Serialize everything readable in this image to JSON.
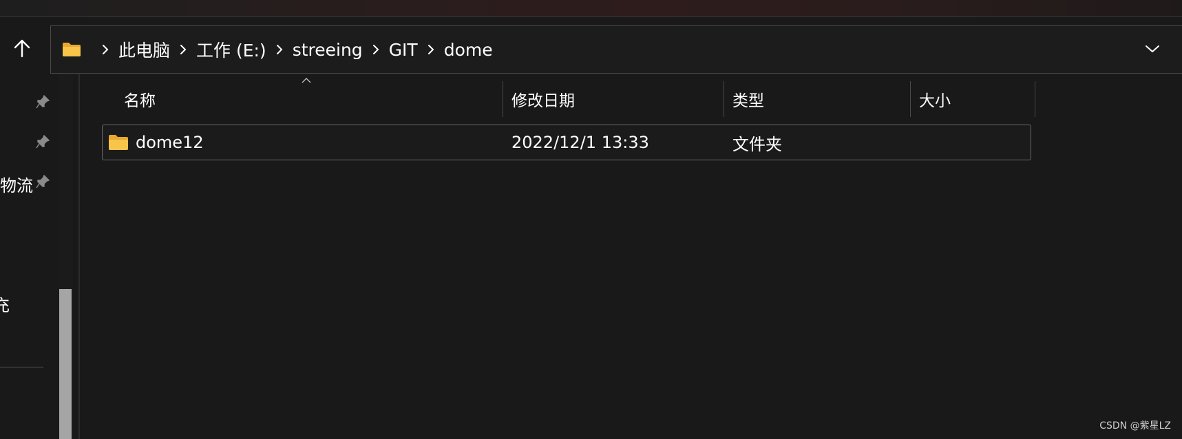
{
  "breadcrumbs": [
    "此电脑",
    "工作 (E:)",
    "streeing",
    "GIT",
    "dome"
  ],
  "nav_pane": {
    "items": [
      {
        "label": "",
        "pinned": true
      },
      {
        "label": "",
        "pinned": true
      },
      {
        "label": "物流",
        "pinned": true
      },
      {
        "label": "充",
        "pinned": false
      }
    ]
  },
  "columns": {
    "name": "名称",
    "modified": "修改日期",
    "type": "类型",
    "size": "大小"
  },
  "files": [
    {
      "name": "dome12",
      "modified": "2022/12/1 13:33",
      "type": "文件夹",
      "size": "",
      "icon": "folder-icon"
    }
  ],
  "watermark": "CSDN @紫星LZ",
  "colors": {
    "background": "#191919",
    "folder": "#f8c44a",
    "border": "#4a4a4a",
    "scroll_thumb": "#a5a5a5"
  }
}
